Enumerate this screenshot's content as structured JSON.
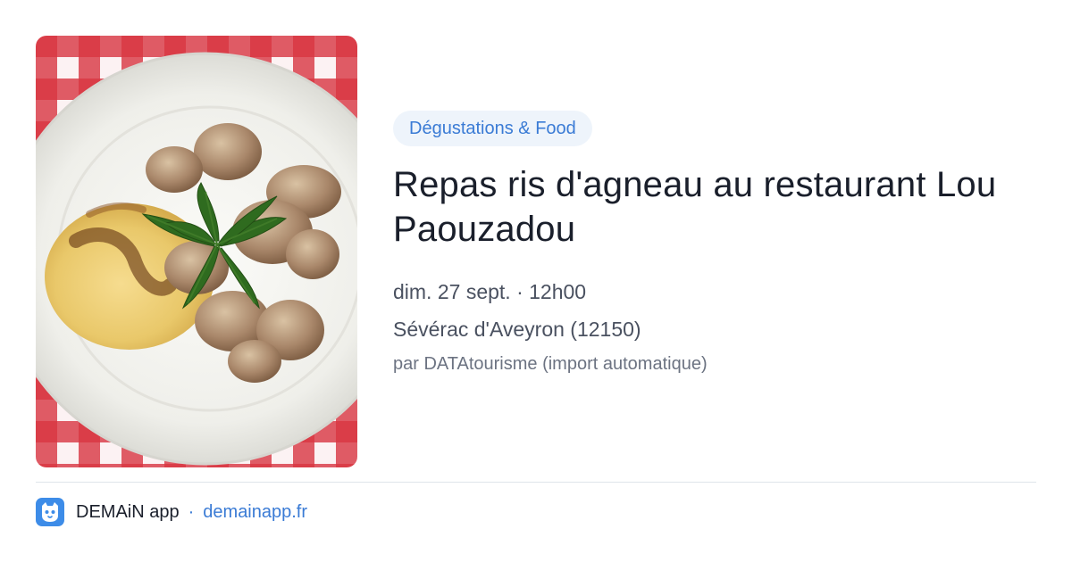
{
  "card": {
    "image_alt": "",
    "category": "Dégustations & Food",
    "title": "Repas ris d'agneau au restaurant Lou Paouzadou",
    "datetime": "dim. 27 sept. · 12h00",
    "location": "Sévérac d'Aveyron (12150)",
    "source": "par DATAtourisme (import automatique)"
  },
  "footer": {
    "app_name": "DEMAiN app",
    "separator": "·",
    "domain": "demainapp.fr",
    "logo_icon": "cat-face-icon"
  },
  "colors": {
    "accent": "#3a7bd5",
    "badge_bg": "#eef4fb",
    "title": "#1a1f2b",
    "logo_bg": "#3d8ce8"
  }
}
